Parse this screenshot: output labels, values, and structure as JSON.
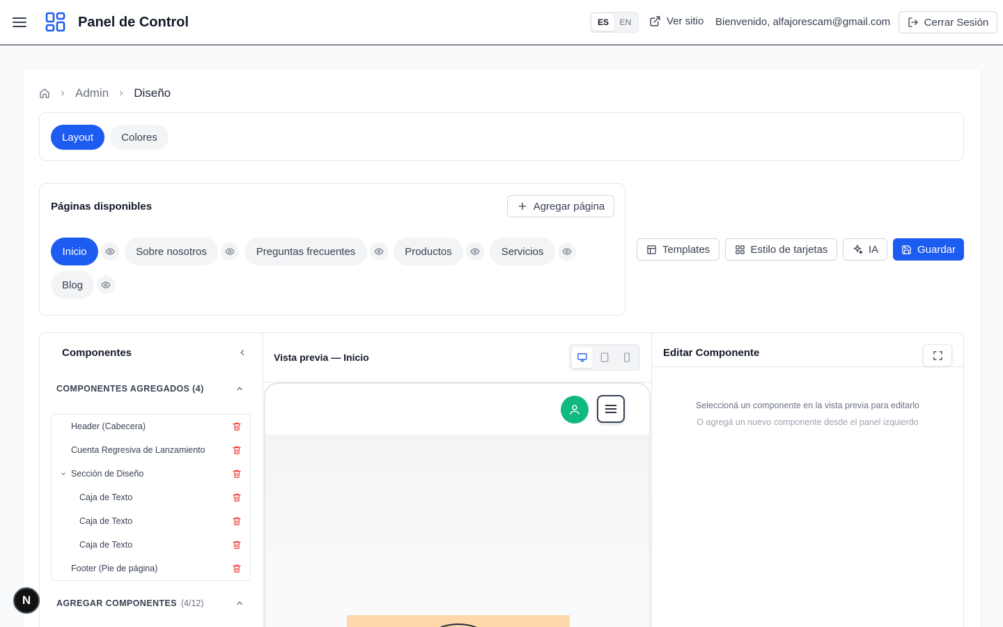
{
  "header": {
    "title": "Panel de Control",
    "lang_es": "ES",
    "lang_en": "EN",
    "view_site": "Ver sitio",
    "welcome": "Bienvenido, alfajorescam@gmail.com",
    "logout": "Cerrar Sesión"
  },
  "breadcrumb": {
    "admin": "Admin",
    "current": "Diseño"
  },
  "tabs": {
    "layout": "Layout",
    "colors": "Colores"
  },
  "pages": {
    "title": "Páginas disponibles",
    "add_page": "Agregar página",
    "items": [
      "Inicio",
      "Sobre nosotros",
      "Preguntas frecuentes",
      "Productos",
      "Servicios",
      "Blog"
    ]
  },
  "toolbar": {
    "templates": "Templates",
    "card_style": "Estilo de tarjetas",
    "ai": "IA",
    "save": "Guardar"
  },
  "components": {
    "title": "Componentes",
    "added_label": "COMPONENTES AGREGADOS (4)",
    "tree": [
      "Header (Cabecera)",
      "Cuenta Regresiva de Lanzamiento",
      "Sección de Diseño",
      "Caja de Texto",
      "Caja de Texto",
      "Caja de Texto",
      "Footer (Pie de página)"
    ],
    "add_label": "AGREGAR COMPONENTES",
    "add_count": "(4/12)"
  },
  "preview": {
    "title": "Vista previa — Inicio"
  },
  "edit": {
    "title": "Editar Componente",
    "hint1": "Seleccioná un componente en la vista previa para editarlo",
    "hint2": "O agregá un nuevo componente desde el panel izquierdo"
  },
  "badge": "N",
  "colors": {
    "accent": "#1d5cf0",
    "danger": "#ef4444",
    "avatar": "#10b981",
    "preview_block": "#fed7aa"
  }
}
